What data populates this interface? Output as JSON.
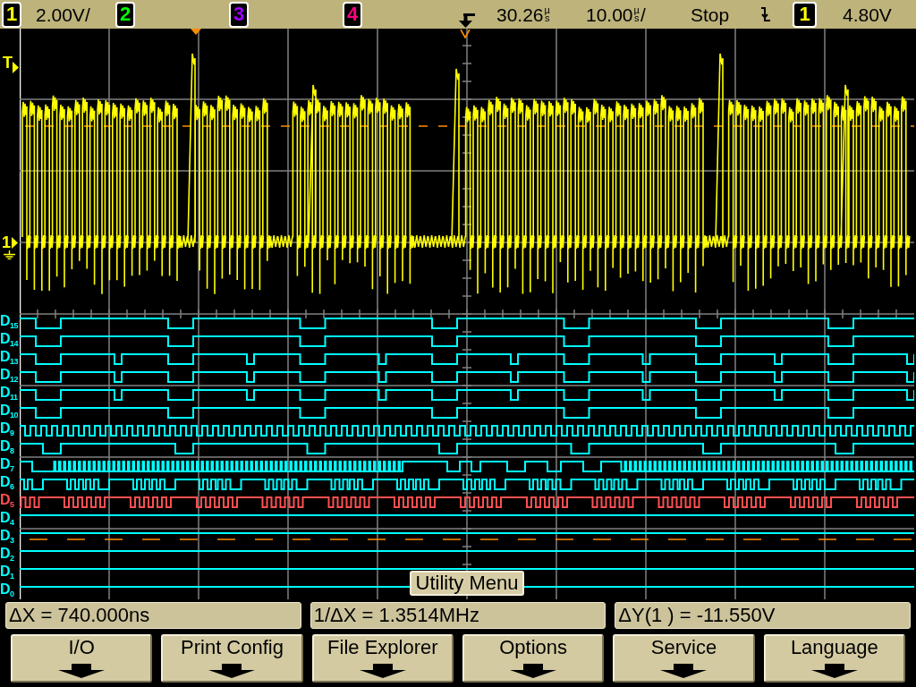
{
  "status_bar": {
    "channels": [
      {
        "number": "1",
        "color": "#ffff00",
        "scale": "2.00V/"
      },
      {
        "number": "2",
        "color": "#00ff00"
      },
      {
        "number": "3",
        "color": "#a000ff"
      },
      {
        "number": "4",
        "color": "#ff0080"
      }
    ],
    "delay": {
      "value": "30.26",
      "unit": "µs"
    },
    "timebase": {
      "value": "10.00",
      "unit": "µs",
      "suffix": "/"
    },
    "run_state": "Stop",
    "trigger": {
      "source": "1",
      "color": "#ffff00",
      "level": "4.80V"
    }
  },
  "display": {
    "analog_markers": [
      {
        "label": "T",
        "kind": "trigger"
      },
      {
        "label": "1",
        "kind": "ground"
      }
    ],
    "digital_channels": [
      {
        "label": "D$_{15}$",
        "color": "#00ffff"
      },
      {
        "label": "D$_{14}$",
        "color": "#00ffff"
      },
      {
        "label": "D$_{13}$",
        "color": "#00ffff"
      },
      {
        "label": "D$_{12}$",
        "color": "#00ffff"
      },
      {
        "label": "D$_{11}$",
        "color": "#00ffff"
      },
      {
        "label": "D$_{10}$",
        "color": "#00ffff"
      },
      {
        "label": "D$_{9}$",
        "color": "#00ffff"
      },
      {
        "label": "D$_{8}$",
        "color": "#00ffff"
      },
      {
        "label": "D$_{7}$",
        "color": "#00ffff"
      },
      {
        "label": "D$_{6}$",
        "color": "#00ffff"
      },
      {
        "label": "D$_{5}$",
        "color": "#ff5050"
      },
      {
        "label": "D$_{4}$",
        "color": "#00ffff"
      },
      {
        "label": "D$_{3}$",
        "color": "#00ffff"
      },
      {
        "label": "D$_{2}$",
        "color": "#00ffff"
      },
      {
        "label": "D$_{1}$",
        "color": "#00ffff"
      },
      {
        "label": "D$_{0}$",
        "color": "#00ffff"
      }
    ]
  },
  "menu_title": "Utility Menu",
  "measurements": [
    "ΔX = 740.000ns",
    "1/ΔX = 1.3514MHz",
    "ΔY(1 ) = -11.550V"
  ],
  "softkeys": [
    {
      "label": "I/O"
    },
    {
      "label": "Print Config"
    },
    {
      "label": "File Explorer"
    },
    {
      "label": "Options"
    },
    {
      "label": "Service"
    },
    {
      "label": "Language"
    }
  ]
}
